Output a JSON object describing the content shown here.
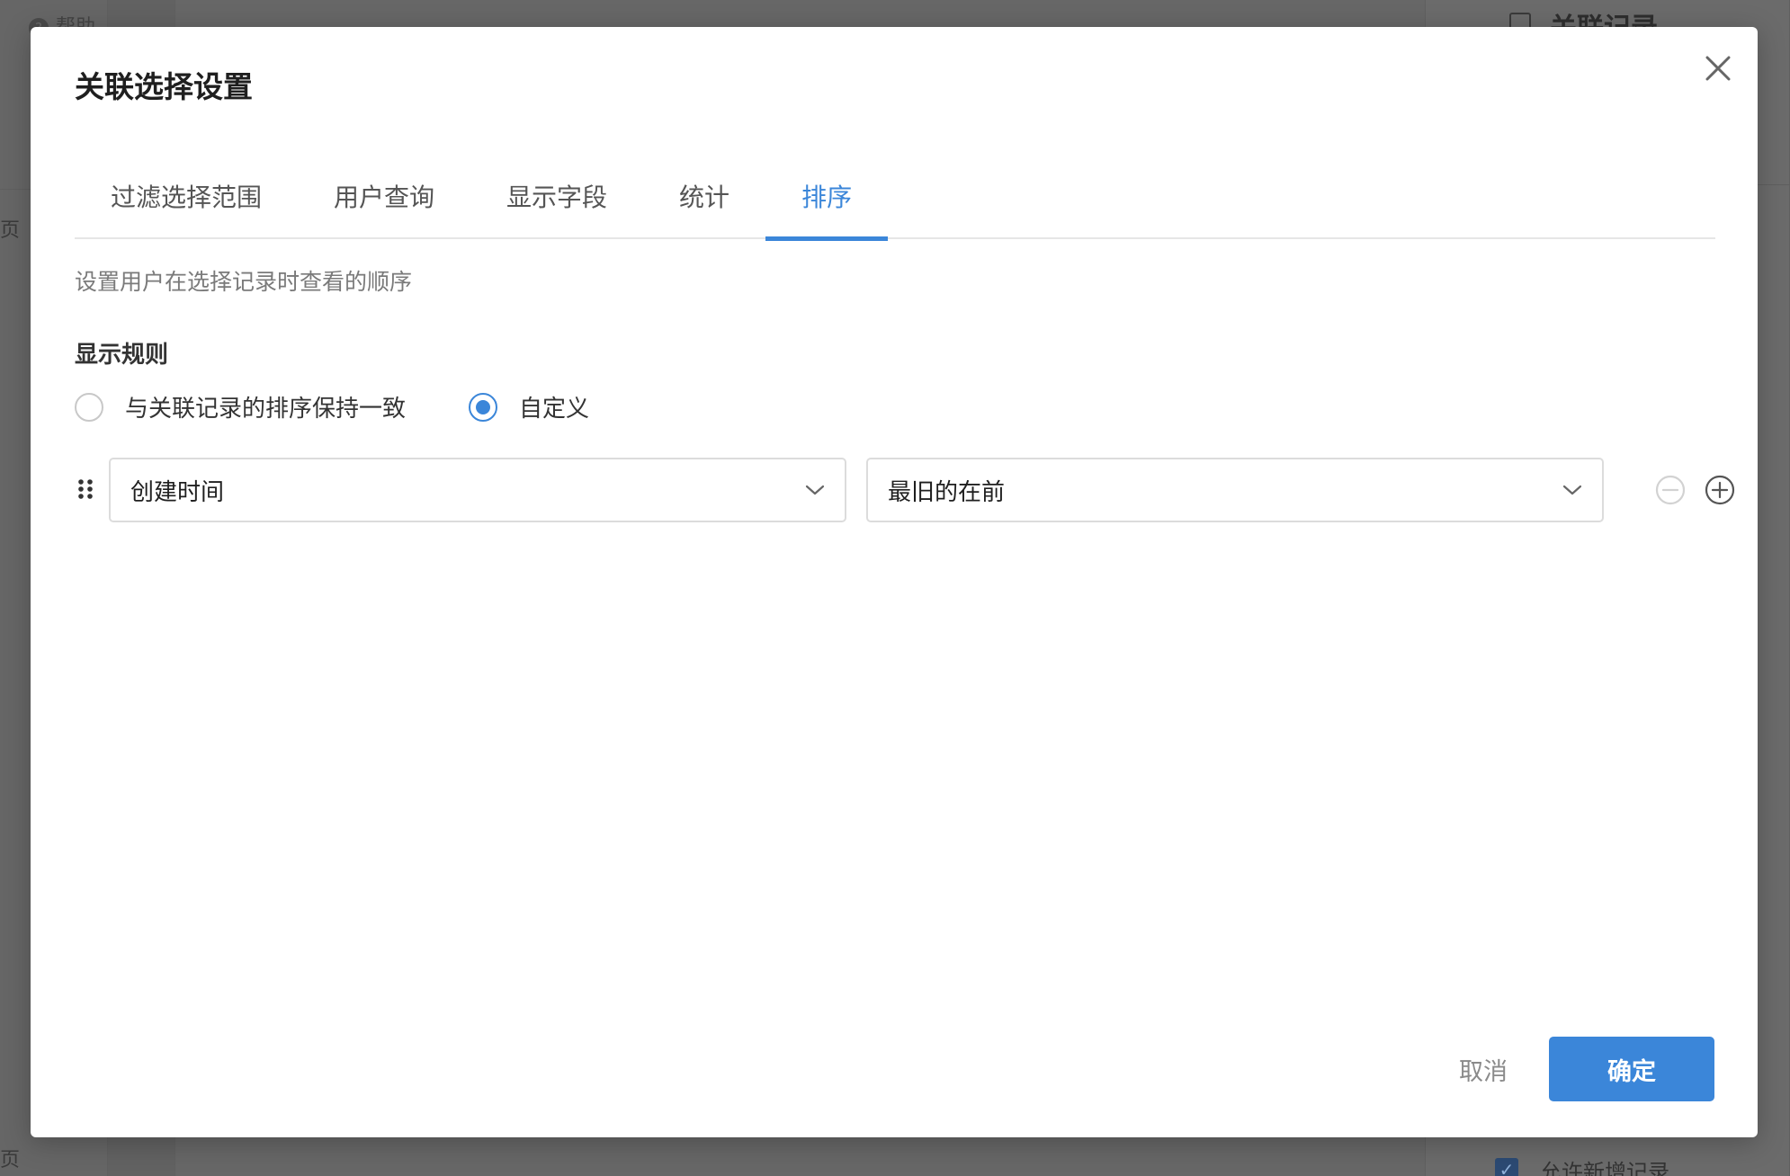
{
  "background": {
    "help_label": "帮助",
    "related_records_label": "关联记录",
    "allow_add_label": "允许新增记录",
    "page_label": "页"
  },
  "modal": {
    "title": "关联选择设置",
    "tabs": [
      {
        "label": "过滤选择范围",
        "active": false
      },
      {
        "label": "用户查询",
        "active": false
      },
      {
        "label": "显示字段",
        "active": false
      },
      {
        "label": "统计",
        "active": false
      },
      {
        "label": "排序",
        "active": true
      }
    ],
    "description": "设置用户在选择记录时查看的顺序",
    "rule_title": "显示规则",
    "radio_options": [
      {
        "label": "与关联记录的排序保持一致",
        "checked": false
      },
      {
        "label": "自定义",
        "checked": true
      }
    ],
    "sort_rule": {
      "field": "创建时间",
      "order": "最旧的在前"
    },
    "footer": {
      "cancel_label": "取消",
      "confirm_label": "确定"
    }
  },
  "colors": {
    "accent": "#3b86d9",
    "overlay": "#666666"
  }
}
